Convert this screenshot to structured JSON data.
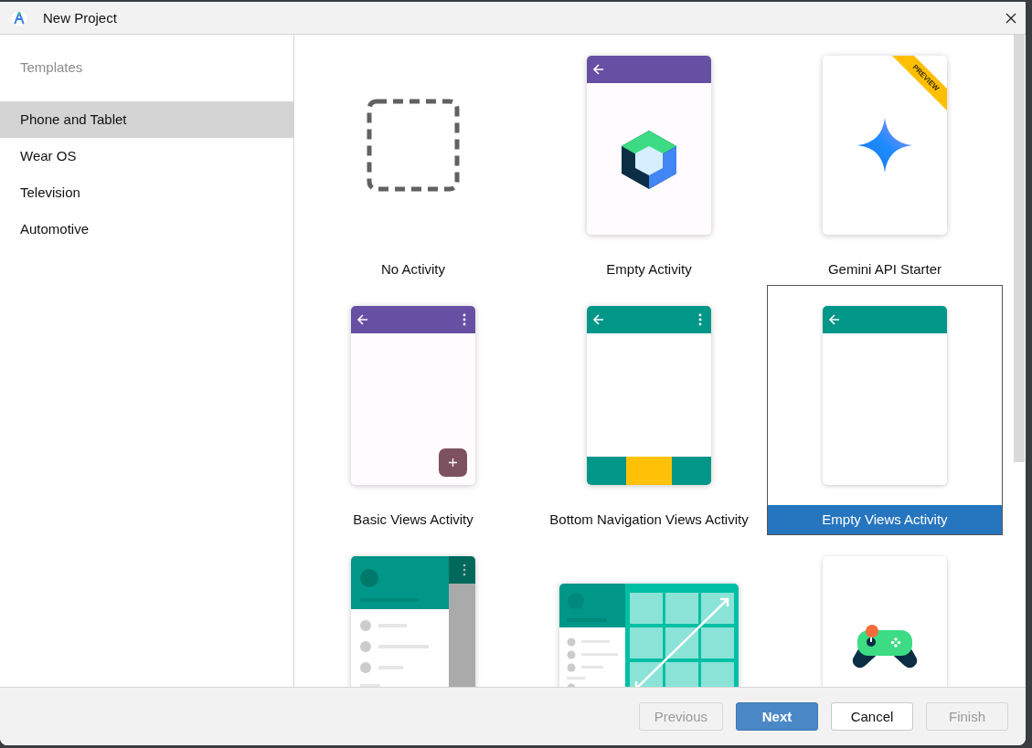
{
  "window": {
    "title": "New Project"
  },
  "sidebar": {
    "heading": "Templates",
    "items": [
      {
        "label": "Phone and Tablet",
        "selected": true
      },
      {
        "label": "Wear OS",
        "selected": false
      },
      {
        "label": "Television",
        "selected": false
      },
      {
        "label": "Automotive",
        "selected": false
      }
    ]
  },
  "templates": [
    {
      "kind": "blank",
      "label": "No Activity",
      "selected": false
    },
    {
      "kind": "compose",
      "label": "Empty Activity",
      "selected": false
    },
    {
      "kind": "gemini",
      "label": "Gemini API Starter",
      "badge": "PREVIEW",
      "selected": false
    },
    {
      "kind": "basic",
      "label": "Basic Views Activity",
      "selected": false
    },
    {
      "kind": "bottomnav",
      "label": "Bottom Navigation Views Activity",
      "selected": false
    },
    {
      "kind": "emptyviews",
      "label": "Empty Views Activity",
      "selected": true
    },
    {
      "kind": "navdrawer",
      "selected": false
    },
    {
      "kind": "responsive",
      "selected": false
    },
    {
      "kind": "game",
      "selected": false
    }
  ],
  "buttons": [
    {
      "label": "Previous",
      "kind": "default",
      "disabled": true
    },
    {
      "label": "Next",
      "kind": "primary",
      "disabled": false
    },
    {
      "label": "Cancel",
      "kind": "default",
      "disabled": false
    },
    {
      "label": "Finish",
      "kind": "default",
      "disabled": true
    }
  ]
}
